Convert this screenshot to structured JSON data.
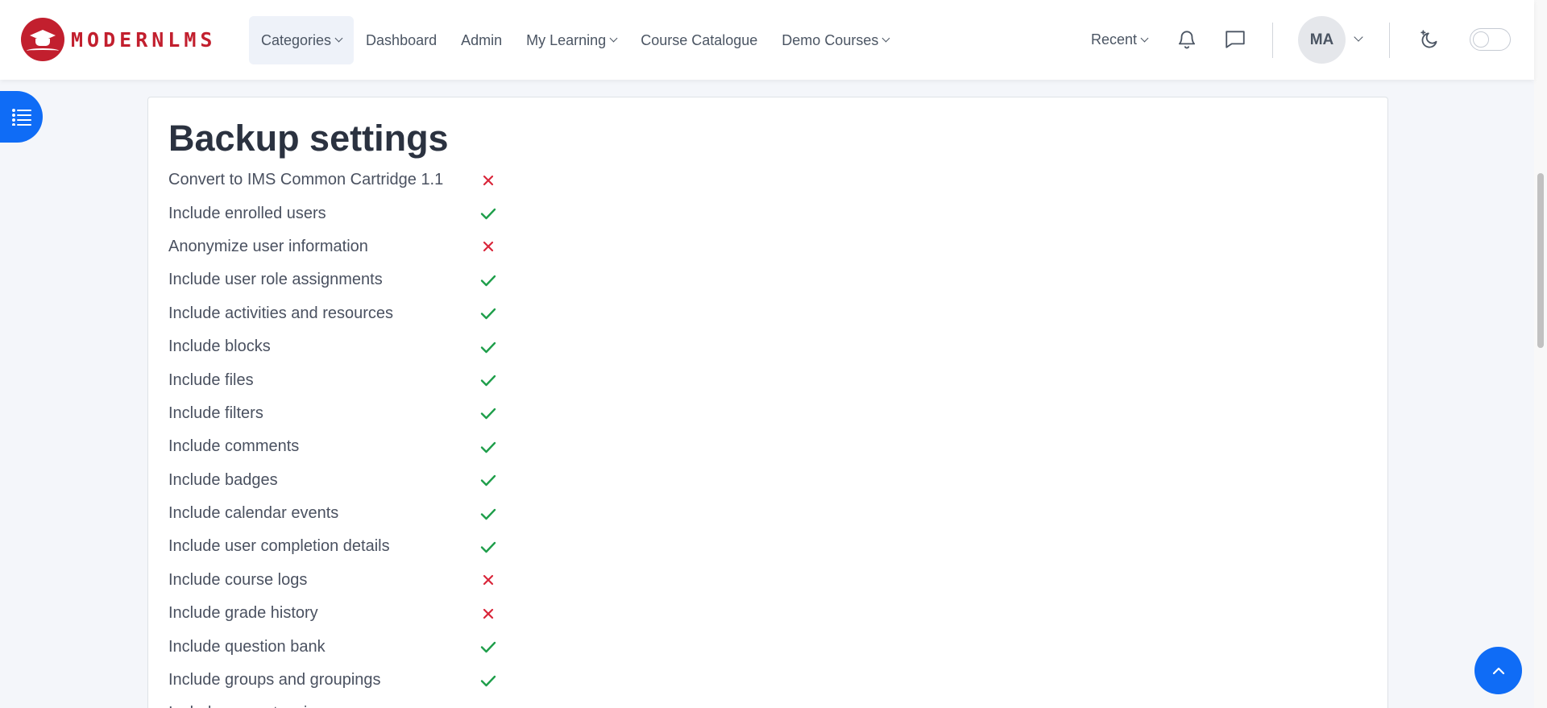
{
  "brand": {
    "name": "MODERNLMS"
  },
  "nav": {
    "items": [
      {
        "label": "Categories",
        "dropdown": true,
        "active": true
      },
      {
        "label": "Dashboard",
        "dropdown": false
      },
      {
        "label": "Admin",
        "dropdown": false
      },
      {
        "label": "My Learning",
        "dropdown": true
      },
      {
        "label": "Course Catalogue",
        "dropdown": false
      },
      {
        "label": "Demo Courses",
        "dropdown": true
      }
    ],
    "recent_label": "Recent",
    "user_initials": "MA"
  },
  "icons": {
    "notifications": "bell-icon",
    "messages": "chat-bubble-icon",
    "theme": "moon-icon",
    "drawer": "list-icon",
    "scroll_top": "chevron-up-icon"
  },
  "colors": {
    "accent": "#0f6cf6",
    "brand": "#c21f2e",
    "yes": "#1e9e4a",
    "no": "#d9263a"
  },
  "section": {
    "title": "Backup settings",
    "settings": [
      {
        "label": "Convert to IMS Common Cartridge 1.1",
        "enabled": false
      },
      {
        "label": "Include enrolled users",
        "enabled": true
      },
      {
        "label": "Anonymize user information",
        "enabled": false
      },
      {
        "label": "Include user role assignments",
        "enabled": true
      },
      {
        "label": "Include activities and resources",
        "enabled": true
      },
      {
        "label": "Include blocks",
        "enabled": true
      },
      {
        "label": "Include files",
        "enabled": true
      },
      {
        "label": "Include filters",
        "enabled": true
      },
      {
        "label": "Include comments",
        "enabled": true
      },
      {
        "label": "Include badges",
        "enabled": true
      },
      {
        "label": "Include calendar events",
        "enabled": true
      },
      {
        "label": "Include user completion details",
        "enabled": true
      },
      {
        "label": "Include course logs",
        "enabled": false
      },
      {
        "label": "Include grade history",
        "enabled": false
      },
      {
        "label": "Include question bank",
        "enabled": true
      },
      {
        "label": "Include groups and groupings",
        "enabled": true
      },
      {
        "label": "Include competencies",
        "enabled": true
      }
    ]
  }
}
